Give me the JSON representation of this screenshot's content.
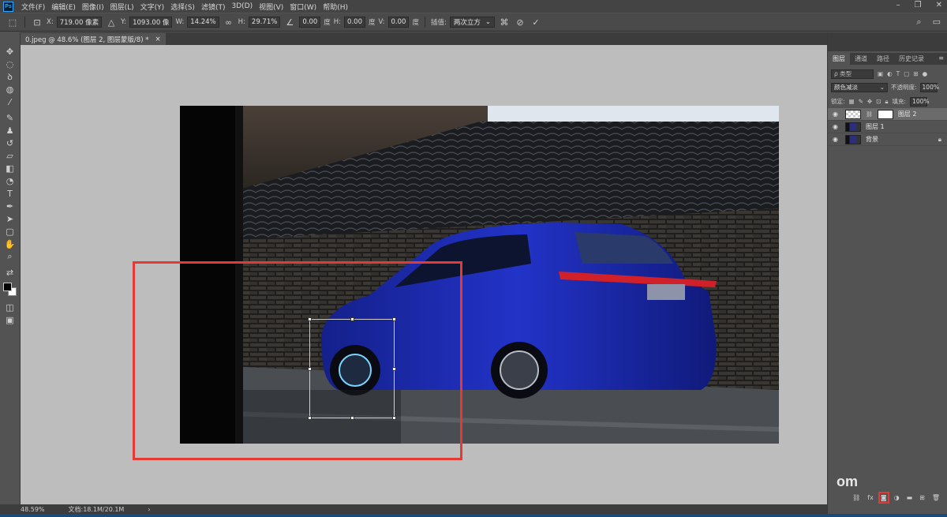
{
  "menubar": {
    "logo": "Ps",
    "items": [
      "文件(F)",
      "编辑(E)",
      "图像(I)",
      "图层(L)",
      "文字(Y)",
      "选择(S)",
      "滤镜(T)",
      "3D(D)",
      "视图(V)",
      "窗口(W)",
      "帮助(H)"
    ]
  },
  "options": {
    "x_label": "X:",
    "x_value": "719.00 像素",
    "y_label": "Y:",
    "y_value": "1093.00 像",
    "w_label": "W:",
    "w_value": "14.24%",
    "h_label": "H:",
    "h_value": "29.71%",
    "angle_value": "0.00",
    "angle_unit": "度",
    "hskew_label": "H:",
    "hskew_value": "0.00",
    "hskew_unit": "度",
    "vskew_label": "V:",
    "vskew_value": "0.00",
    "vskew_unit": "度",
    "interp_label": "插值:",
    "interp_value": "两次立方"
  },
  "document": {
    "tab_title": "0.jpeg @ 48.6% (图层 2, 图层蒙版/8) *",
    "close": "×"
  },
  "status": {
    "zoom": "48.59%",
    "doc_size": "文档:18.1M/20.1M"
  },
  "layers_panel": {
    "tabs": [
      "图层",
      "通道",
      "路径",
      "历史记录"
    ],
    "filter_placeholder": "ρ 类型",
    "blend_mode": "颜色减淡",
    "opacity_label": "不透明度:",
    "opacity_value": "100%",
    "lock_label": "锁定:",
    "fill_label": "填充:",
    "fill_value": "100%",
    "layers": [
      {
        "name": "图层 2"
      },
      {
        "name": "图层 1"
      },
      {
        "name": "背景"
      }
    ]
  },
  "watermark": "om",
  "colors": {
    "highlight": "#e53935",
    "car": "#1b2bb5"
  }
}
